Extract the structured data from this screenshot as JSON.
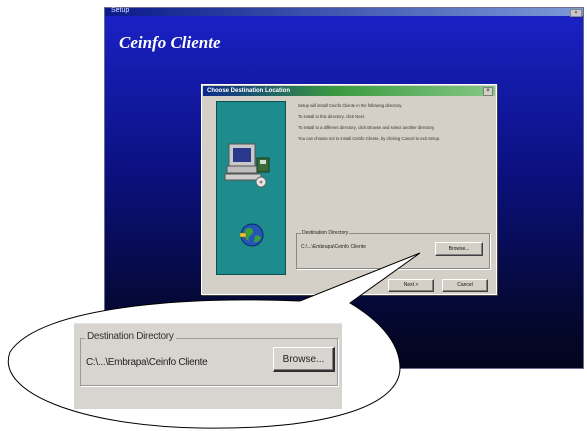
{
  "window": {
    "titlebar_text": "Setup",
    "close_glyph": "×",
    "app_title": "Ceinfo Cliente"
  },
  "dialog": {
    "title": "Choose Destination Location",
    "close_glyph": "×",
    "paragraphs": [
      "Setup will install Ceinfo Cliente in the following directory.",
      "To install to this directory, click Next.",
      "To install to a different directory, click Browse and select another directory.",
      "You can choose not to install Ceinfo Cliente, by clicking Cancel to exit Setup."
    ],
    "group_label": "Destination Directory",
    "path": "C:\\...\\Embrapa\\Ceinfo Cliente",
    "browse_label": "Browse...",
    "next_label": "Next >",
    "cancel_label": "Cancel"
  },
  "zoom": {
    "group_label": "Destination Directory",
    "path": "C:\\...\\Embrapa\\Ceinfo Cliente",
    "browse_label": "Browse..."
  },
  "colors": {
    "window_gradient_top": "#1a22c8",
    "window_gradient_bottom": "#03051c",
    "art_panel": "#1e8c8c",
    "dialog_face": "#d4d0c8"
  },
  "icons": {
    "computer": "computer-icon",
    "globe": "globe-icon"
  }
}
